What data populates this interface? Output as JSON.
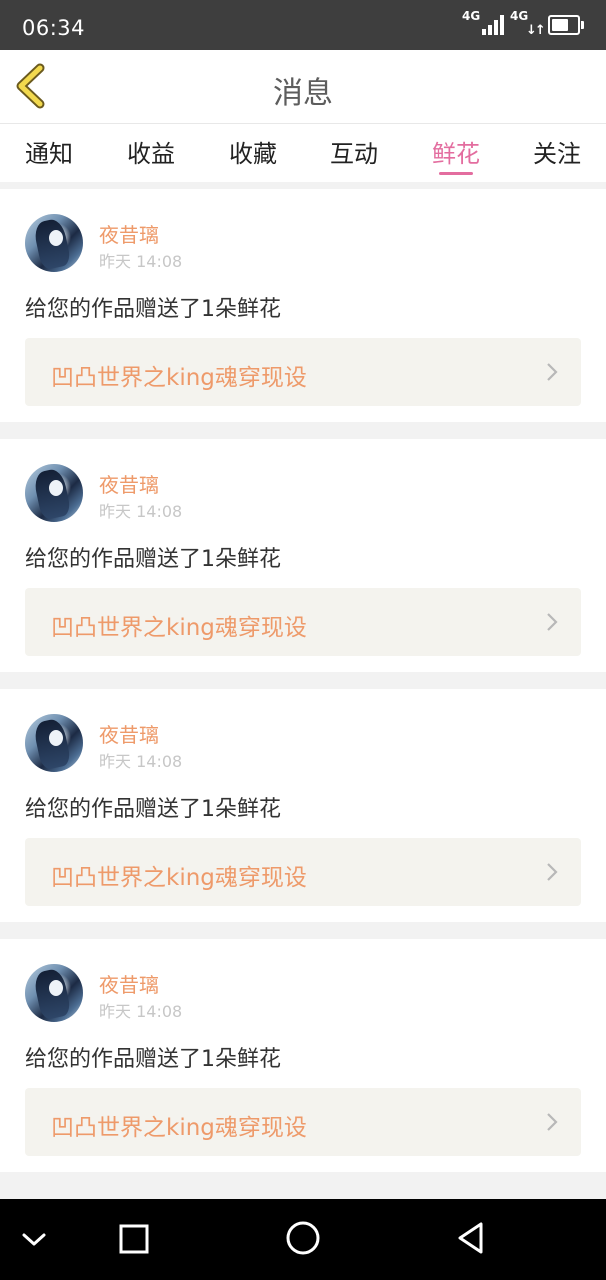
{
  "status_bar": {
    "time": "06:34",
    "network_1": "4G",
    "network_2": "4G",
    "battery_level": 0.8
  },
  "header": {
    "title": "消息",
    "back_icon": "back-chevron-icon",
    "accent_color": "#e36d9f"
  },
  "tabs": [
    {
      "label": "通知",
      "active": false
    },
    {
      "label": "收益",
      "active": false
    },
    {
      "label": "收藏",
      "active": false
    },
    {
      "label": "互动",
      "active": false
    },
    {
      "label": "鲜花",
      "active": true
    },
    {
      "label": "关注",
      "active": false
    }
  ],
  "messages": [
    {
      "user": "夜昔璃",
      "time": "昨天 14:08",
      "text": "给您的作品赠送了1朵鲜花",
      "work": "凹凸世界之king魂穿现设"
    },
    {
      "user": "夜昔璃",
      "time": "昨天 14:08",
      "text": "给您的作品赠送了1朵鲜花",
      "work": "凹凸世界之king魂穿现设"
    },
    {
      "user": "夜昔璃",
      "time": "昨天 14:08",
      "text": "给您的作品赠送了1朵鲜花",
      "work": "凹凸世界之king魂穿现设"
    },
    {
      "user": "夜昔璃",
      "time": "昨天 14:08",
      "text": "给您的作品赠送了1朵鲜花",
      "work": "凹凸世界之king魂穿现设"
    }
  ],
  "nav_bar": {
    "icons": [
      "chevron-down-icon",
      "square-icon",
      "circle-icon",
      "triangle-back-icon"
    ]
  }
}
